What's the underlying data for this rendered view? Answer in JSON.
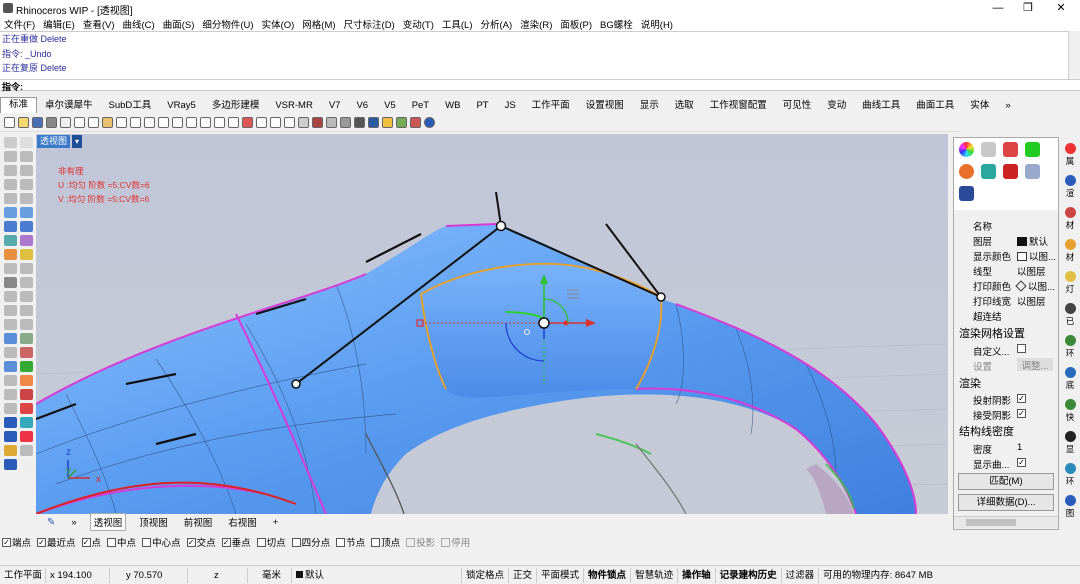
{
  "window": {
    "title": "Rhinoceros WIP - [透视图]",
    "min": "—",
    "restore": "❐",
    "close": "✕"
  },
  "menu": [
    "文件(F)",
    "编辑(E)",
    "查看(V)",
    "曲线(C)",
    "曲面(S)",
    "细分物件(U)",
    "实体(O)",
    "网格(M)",
    "尺寸标注(D)",
    "变动(T)",
    "工具(L)",
    "分析(A)",
    "渲染(R)",
    "面板(P)",
    "BG螺栓",
    "说明(H)"
  ],
  "command_history": [
    "正在重做 Delete",
    "指令: _Undo",
    "正在复原 Delete"
  ],
  "command_prompt": "指令:",
  "tabs": [
    "标准",
    "卓尔谟犀牛",
    "SubD工具",
    "VRay5",
    "多边形建模",
    "VSR-MR",
    "V7",
    "V6",
    "V5",
    "PeT",
    "WB",
    "PT",
    "JS",
    "工作平面",
    "设置视图",
    "显示",
    "选取",
    "工作视窗配置",
    "可见性",
    "变动",
    "曲线工具",
    "曲面工具",
    "实体"
  ],
  "tab_more": "»",
  "viewport": {
    "label": "透视图",
    "arrow": "▾",
    "info": [
      "非有理",
      "U :均匀  阶数 =5;CV数=6",
      "V :均匀  阶数 =5;CV数=6"
    ],
    "axis_x": "x",
    "axis_y": "y",
    "axis_z": "z"
  },
  "viewport_tabs": [
    "透视图",
    "顶视图",
    "前视图",
    "右视图"
  ],
  "viewport_tabs_add": "+",
  "osnap": [
    {
      "label": "端点",
      "checked": true
    },
    {
      "label": "最近点",
      "checked": true
    },
    {
      "label": "点",
      "checked": true
    },
    {
      "label": "中点",
      "checked": false
    },
    {
      "label": "中心点",
      "checked": false
    },
    {
      "label": "交点",
      "checked": true
    },
    {
      "label": "垂点",
      "checked": true
    },
    {
      "label": "切点",
      "checked": false
    },
    {
      "label": "四分点",
      "checked": false
    },
    {
      "label": "节点",
      "checked": false
    },
    {
      "label": "顶点",
      "checked": false
    },
    {
      "label": "投影",
      "checked": false,
      "disabled": true
    },
    {
      "label": "停用",
      "checked": false,
      "disabled": true
    }
  ],
  "status": {
    "cplane": "工作平面",
    "x": "x 194.100",
    "y": "y 70.570",
    "z": "z",
    "unit": "毫米",
    "layer": "默认",
    "toggles": [
      "锁定格点",
      "正交",
      "平面模式",
      "物件锁点",
      "智慧轨迹",
      "操作轴",
      "记录建构历史",
      "过滤器"
    ],
    "memory": "可用的物理内存: 8647 MB"
  },
  "properties": {
    "rows": [
      {
        "k": "名称",
        "v": ""
      },
      {
        "k": "图层",
        "v": "默认"
      },
      {
        "k": "显示颜色",
        "v": "以图..."
      },
      {
        "k": "线型",
        "v": "以图层"
      },
      {
        "k": "打印颜色",
        "v": "以图..."
      },
      {
        "k": "打印线宽",
        "v": "以图层"
      },
      {
        "k": "超连结",
        "v": ""
      }
    ],
    "mesh_header": "渲染网格设置",
    "custom": "自定义...",
    "settings": "设置",
    "adjust": "调整...",
    "render_header": "渲染",
    "cast_shadow": "投射阴影",
    "receive_shadow": "接受阴影",
    "iso_header": "结构线密度",
    "density_label": "密度",
    "density_value": "1",
    "show_curve": "显示曲...",
    "match": "匹配(M)",
    "details": "详细数据(D)..."
  },
  "right_tabs": [
    "属",
    "渲",
    "材",
    "材",
    "灯",
    "已",
    "环",
    "底",
    "快",
    "显",
    "环",
    "图"
  ],
  "colors": {
    "surface": "#5aa0f0",
    "edge_magenta": "#d83ad8",
    "edge_orange": "#f0a020",
    "info_red": "#e03030",
    "viewport_bg": "#c4c8d6",
    "label_blue": "#3a78c8"
  }
}
